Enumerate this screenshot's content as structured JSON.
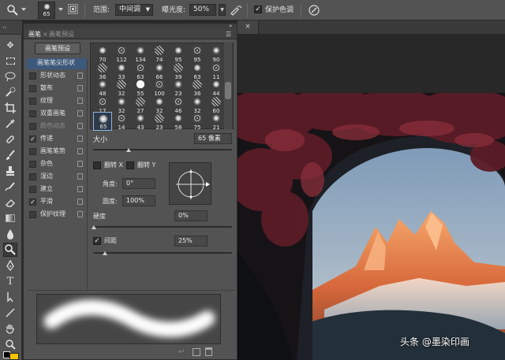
{
  "options_bar": {
    "brush_size": "65",
    "range_label": "范围:",
    "range_value": "中间调",
    "exposure_label": "曝光度:",
    "exposure_value": "50%",
    "protect_tones_label": "保护色调",
    "protect_tones_checked": true
  },
  "panel": {
    "tabs": [
      "画笔",
      "画笔预设"
    ],
    "preset_button": "画笔预设",
    "options": [
      {
        "label": "画笔笔尖形状",
        "checked": null,
        "lock": false,
        "selected": true,
        "dim": false
      },
      {
        "label": "形状动态",
        "checked": false,
        "lock": true,
        "selected": false,
        "dim": false
      },
      {
        "label": "散布",
        "checked": false,
        "lock": true,
        "selected": false,
        "dim": false
      },
      {
        "label": "纹理",
        "checked": false,
        "lock": true,
        "selected": false,
        "dim": false
      },
      {
        "label": "双重画笔",
        "checked": false,
        "lock": true,
        "selected": false,
        "dim": false
      },
      {
        "label": "颜色动态",
        "checked": false,
        "lock": true,
        "selected": false,
        "dim": true
      },
      {
        "label": "传递",
        "checked": true,
        "lock": true,
        "selected": false,
        "dim": false
      },
      {
        "label": "画笔笔势",
        "checked": false,
        "lock": true,
        "selected": false,
        "dim": false
      },
      {
        "label": "杂色",
        "checked": false,
        "lock": true,
        "selected": false,
        "dim": false
      },
      {
        "label": "湿边",
        "checked": false,
        "lock": true,
        "selected": false,
        "dim": false
      },
      {
        "label": "建立",
        "checked": false,
        "lock": true,
        "selected": false,
        "dim": false
      },
      {
        "label": "平滑",
        "checked": true,
        "lock": true,
        "selected": false,
        "dim": false
      },
      {
        "label": "保护纹理",
        "checked": false,
        "lock": true,
        "selected": false,
        "dim": false
      }
    ],
    "tip_sizes": [
      [
        "70",
        "112",
        "134",
        "74",
        "95",
        "95",
        "90"
      ],
      [
        "36",
        "33",
        "63",
        "66",
        "39",
        "63",
        "11"
      ],
      [
        "48",
        "32",
        "55",
        "100",
        "23",
        "36",
        "44"
      ],
      [
        "17",
        "32",
        "27",
        "32",
        "46",
        "32",
        "60"
      ],
      [
        "65",
        "14",
        "43",
        "23",
        "58",
        "75",
        "21"
      ]
    ],
    "size_label": "大小",
    "size_value": "65 像素",
    "flip_x_label": "翻转 X",
    "flip_y_label": "翻转 Y",
    "angle_label": "角度:",
    "angle_value": "0°",
    "roundness_label": "圆度:",
    "roundness_value": "100%",
    "hardness_label": "硬度",
    "hardness_value": "0%",
    "spacing_label": "间距",
    "spacing_value": "25%",
    "spacing_checked": true
  },
  "watermark": "头条 @墨染印画",
  "colors": {
    "panel_bg": "#535353",
    "selected_row": "#3d5a7d",
    "sky": "#8aa3bd",
    "foliage": "#5a1e26"
  }
}
